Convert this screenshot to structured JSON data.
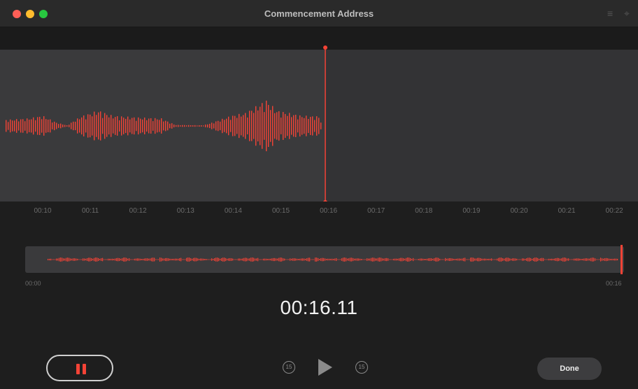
{
  "window": {
    "title": "Commencement Address"
  },
  "toolbar": {
    "transcript_icon": "list-icon",
    "trim_icon": "crop-icon"
  },
  "timeline": {
    "ticks": [
      "00:10",
      "00:11",
      "00:12",
      "00:13",
      "00:14",
      "00:15",
      "00:16",
      "00:17",
      "00:18",
      "00:19",
      "00:20",
      "00:21",
      "00:22"
    ],
    "playhead": "00:16"
  },
  "overview": {
    "start": "00:00",
    "end": "00:16"
  },
  "player": {
    "elapsed": "00:16.11",
    "skip_back": "15",
    "skip_forward": "15",
    "done_label": "Done"
  },
  "colors": {
    "accent": "#f44336",
    "background": "#1e1e1e",
    "wave_bg": "#3a3a3c"
  }
}
